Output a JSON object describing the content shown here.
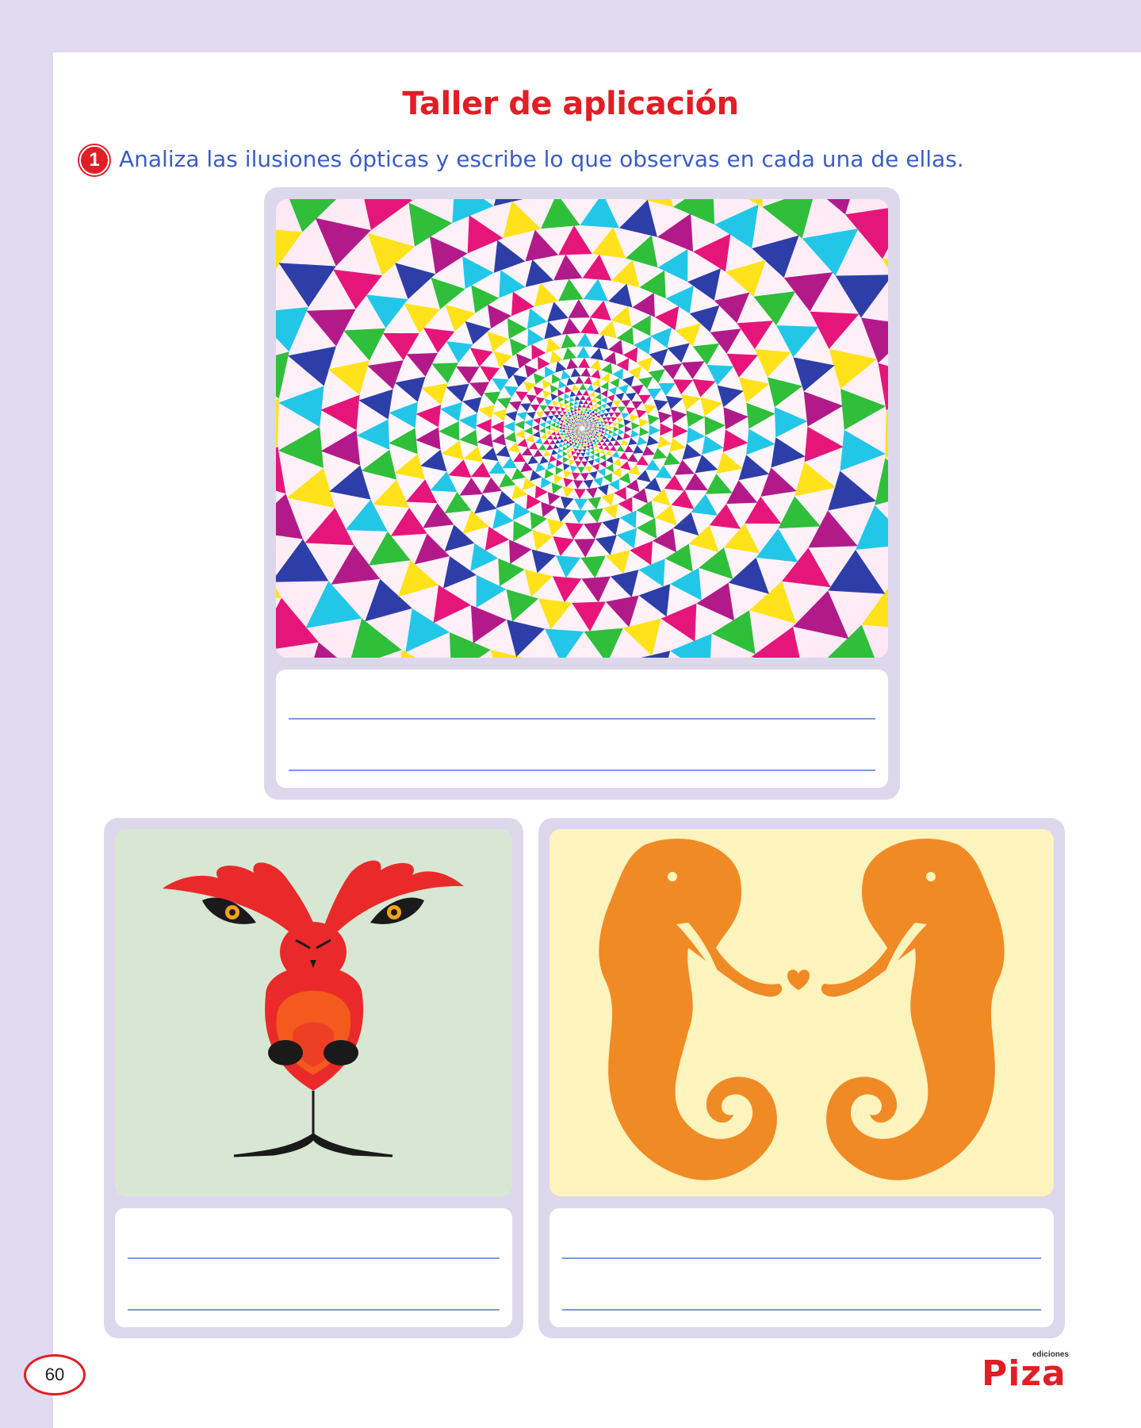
{
  "header": {
    "title": "Taller de aplicación",
    "question_number": "1",
    "instruction": "Analiza las ilusiones ópticas y escribe lo que observas en cada una de ellas."
  },
  "illusions": [
    {
      "name": "psychedelic-spiral",
      "image_bg": "#ffffff"
    },
    {
      "name": "lion-bird-face",
      "image_bg": "#d8e7d4"
    },
    {
      "name": "seahorses",
      "image_bg": "#fdf3bd"
    }
  ],
  "footer": {
    "page_number": "60",
    "logo_small": "ediciones",
    "logo_main": "Piza"
  },
  "colors": {
    "accent_red": "#e01e26",
    "instruction_blue": "#3b5cc4",
    "card_lavender": "#ddd7ec",
    "seahorse_orange": "#f08a24",
    "lion_red": "#ea2a2a"
  }
}
